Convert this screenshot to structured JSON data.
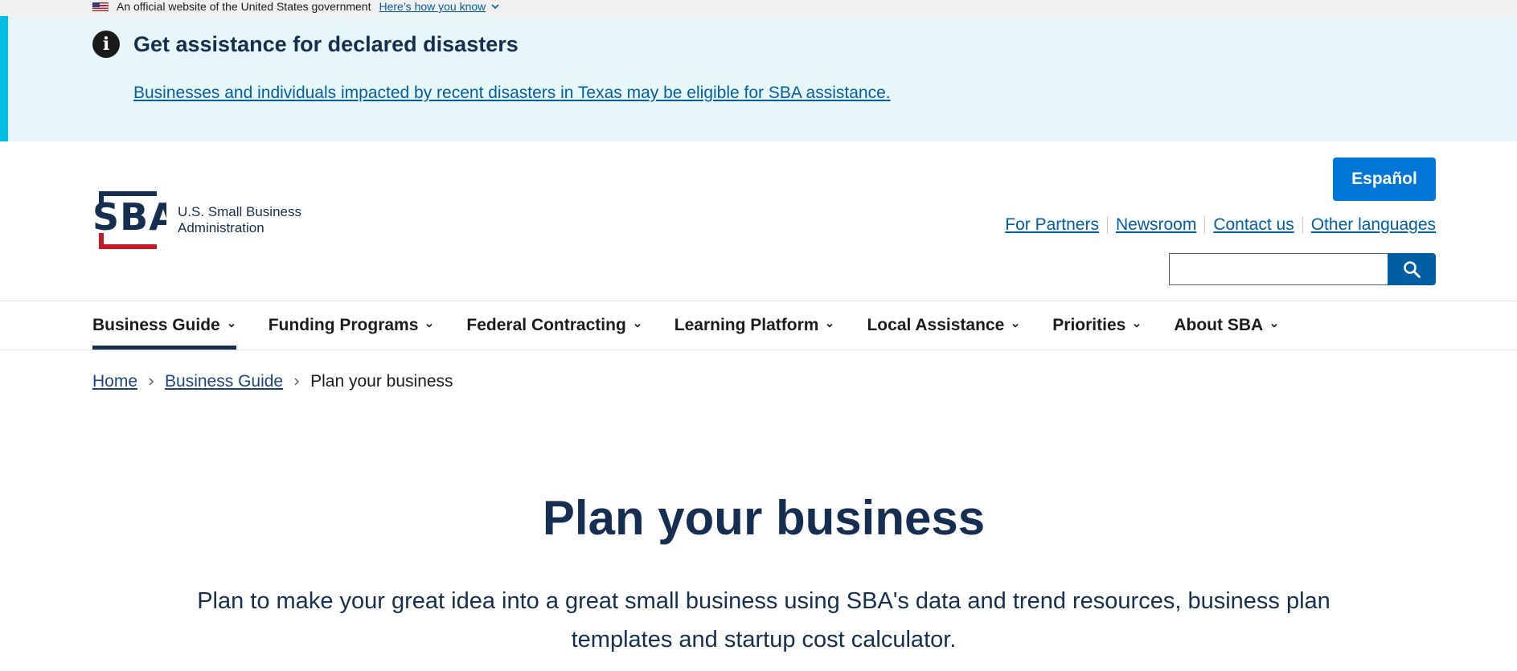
{
  "gov_banner": {
    "text": "An official website of the United States government",
    "link": "Here’s how you know"
  },
  "alert": {
    "title": "Get assistance for declared disasters",
    "link": "Businesses and individuals impacted by recent disasters in Texas may be eligible for SBA assistance."
  },
  "header": {
    "logo_text": "SBA",
    "agency_line1": "U.S. Small Business",
    "agency_line2": "Administration",
    "espanol_label": "Español",
    "utility_links": [
      "For Partners",
      "Newsroom",
      "Contact us",
      "Other languages"
    ],
    "search_placeholder": ""
  },
  "nav": {
    "items": [
      "Business Guide",
      "Funding Programs",
      "Federal Contracting",
      "Learning Platform",
      "Local Assistance",
      "Priorities",
      "About SBA"
    ],
    "active": "Business Guide"
  },
  "breadcrumb": {
    "items": [
      "Home",
      "Business Guide"
    ],
    "current": "Plan your business"
  },
  "hero": {
    "title": "Plan your business",
    "description": "Plan to make your great idea into a great small business using SBA's data and trend resources, business plan templates and startup cost calculator."
  },
  "colors": {
    "navy": "#162e51",
    "link": "#005ea2",
    "button": "#0076d6",
    "alert_bg": "#e7f6f8",
    "alert_border": "#00bde3",
    "logo_red": "#c41a28"
  },
  "icons": {
    "alert": "info-icon",
    "search": "search-icon",
    "nav_chevron": "chevron-down-icon",
    "breadcrumb_separator": "chevron-right-icon",
    "flag": "us-flag-icon"
  }
}
